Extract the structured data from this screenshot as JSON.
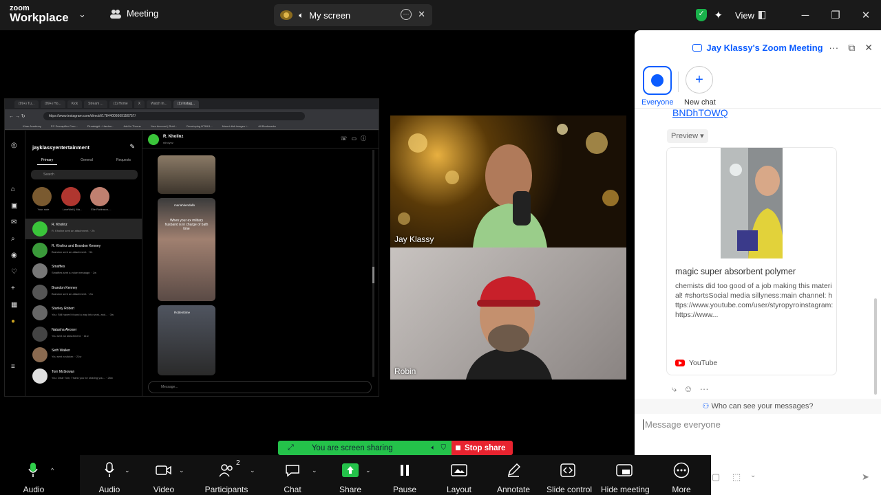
{
  "window": {
    "logo_line1": "zoom",
    "logo_line2": "Workplace",
    "meeting_label": "Meeting",
    "my_screen_label": "My screen",
    "view_label": "View"
  },
  "browser": {
    "tabs": [
      "(99+) Tu...",
      "(99+) Ho...",
      "Kick",
      "Stream ...",
      "(1) Home",
      "X",
      "Watch In...",
      "(1) Instag..."
    ],
    "url": "https://www.instagram.com/direct/t/17844006669156757/",
    "bookmarks": [
      "Khan Academy",
      "PC Decrapifier Com...",
      "Pluralsight - Harden...",
      "Add to Throne",
      "Your Account | Robl...",
      "Developing HTML5...",
      "Mount disk images i...",
      "All Bookmarks"
    ]
  },
  "instagram": {
    "username": "jayklassyentertainment",
    "tabs": [
      "Primary",
      "General",
      "Requests"
    ],
    "search_placeholder": "Search",
    "notes": [
      "Your note",
      "LoveWell | Ma...",
      "Elle Robinson-..."
    ],
    "conversations": [
      {
        "name": "R. Kholinz",
        "preview": "R. Kholinz sent an attachment. · 2h"
      },
      {
        "name": "R. Kholinz and Brandon Kenney",
        "preview": "Brandon sent an attachment. · 5h"
      },
      {
        "name": "Smaffies",
        "preview": "Smaffies sent a voice message. · 2w"
      },
      {
        "name": "Brandon Kenney",
        "preview": "Brandon sent an attachment. · 2w"
      },
      {
        "name": "Stanley Robert",
        "preview": "You: Still haven't found a way into work, and... · 3w"
      },
      {
        "name": "Natasha Alexser",
        "preview": "You sent an attachment. · 11w"
      },
      {
        "name": "Seth Walker",
        "preview": "You sent a sticker. · 21w"
      },
      {
        "name": "Tom McGowan",
        "preview": "You: Dear Tom, Thank you for sharing you... · 26w"
      }
    ],
    "chat_name": "R. Kholinz",
    "chat_sub": "rkholynz",
    "message_placeholder": "Message...",
    "reel_caption": "When your ex military husband is in charge of bath time",
    "reel_user1": "mariahkendallx",
    "reel_user2": "Rottenttime"
  },
  "tiles": [
    {
      "name": "Jay Klassy"
    },
    {
      "name": "Robin"
    }
  ],
  "chat": {
    "title": "Jay Klassy's Zoom Meeting",
    "tab_everyone": "Everyone",
    "tab_new_chat": "New chat",
    "link_fragment": "BNDhTOWQ",
    "preview_label": "Preview ▾",
    "card_title": "magic super absorbent polymer",
    "card_desc": "chemists did too good of a job making this material! #shortsSocial media sillyness:main channel: https://www.youtube.com/user/styropyroinstagram: https://www...",
    "card_source": "YouTube",
    "who_can_see": "Who can see your messages?",
    "input_placeholder": "Message everyone"
  },
  "share_banner": {
    "text": "You are screen sharing",
    "stop_label": "Stop share"
  },
  "toolbar": {
    "audio": "Audio",
    "participants_count": "2",
    "items": [
      "Video",
      "Participants",
      "Chat",
      "Share",
      "Pause",
      "Layout",
      "Annotate",
      "Slide control",
      "Hide meeting",
      "More"
    ]
  },
  "colors": {
    "zoom_blue": "#0b5cff",
    "share_green": "#24c24a",
    "stop_red": "#e8232f",
    "toolbar_bg": "#111111"
  }
}
